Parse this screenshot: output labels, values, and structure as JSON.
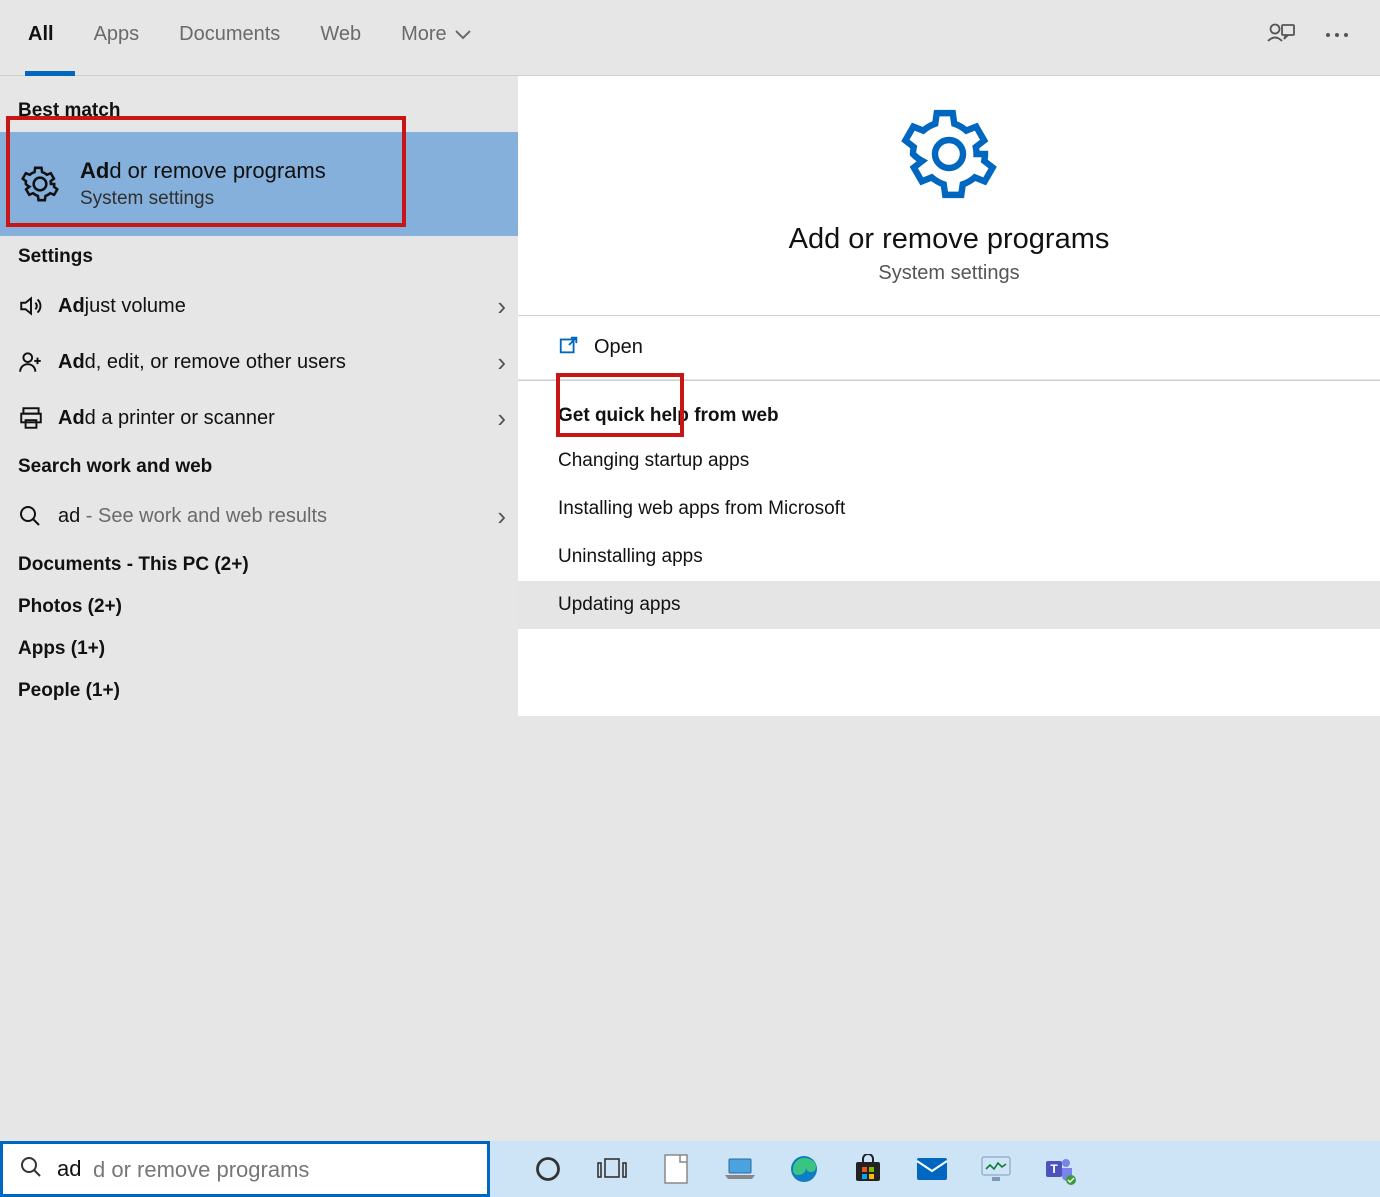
{
  "filter_tabs": {
    "all": "All",
    "apps": "Apps",
    "documents": "Documents",
    "web": "Web",
    "more": "More"
  },
  "sections": {
    "best_match": "Best match",
    "settings": "Settings",
    "search_work_web": "Search work and web",
    "documents_pc": "Documents - This PC (2+)",
    "photos": "Photos (2+)",
    "apps": "Apps (1+)",
    "people": "People (1+)"
  },
  "best_match_item": {
    "bold": "Ad",
    "rest": "d or remove programs",
    "subtitle": "System settings"
  },
  "settings_items": [
    {
      "prefix": "Ad",
      "rest": "just volume",
      "icon": "speaker"
    },
    {
      "prefix": "Ad",
      "rest": "d, edit, or remove other users",
      "icon": "user-plus"
    },
    {
      "prefix": "Ad",
      "rest": "d a printer or scanner",
      "icon": "printer"
    }
  ],
  "web_item": {
    "prefix": "ad",
    "rest": " - See work and web results"
  },
  "detail": {
    "title": "Add or remove programs",
    "subtitle": "System settings",
    "open": "Open",
    "quick_help_title": "Get quick help from web",
    "quick_links": [
      "Changing startup apps",
      "Installing web apps from Microsoft",
      "Uninstalling apps",
      "Updating apps"
    ]
  },
  "search": {
    "typed": "ad",
    "ghost": "d or remove programs"
  },
  "taskbar_icons": [
    "cortana",
    "task-view",
    "document",
    "laptop",
    "edge",
    "store",
    "mail",
    "monitor",
    "teams"
  ]
}
